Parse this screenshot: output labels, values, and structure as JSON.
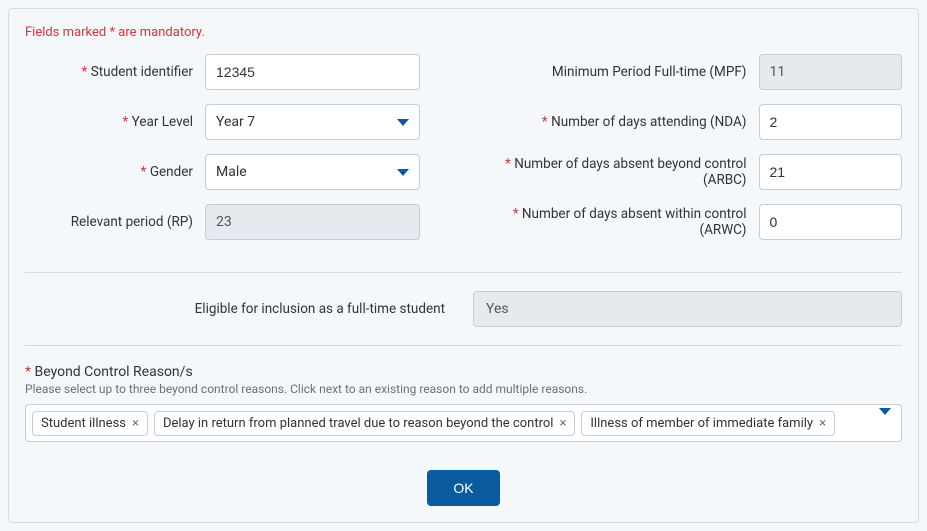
{
  "mandatory_note": {
    "prefix": "Fields marked ",
    "asterisk": "*",
    "suffix": " are mandatory."
  },
  "left": {
    "student_identifier": {
      "label": "Student identifier",
      "value": "12345"
    },
    "year_level": {
      "label": "Year Level",
      "value": "Year 7"
    },
    "gender": {
      "label": "Gender",
      "value": "Male"
    },
    "relevant_period": {
      "label": "Relevant period (RP)",
      "value": "23"
    }
  },
  "right": {
    "mpf": {
      "label": "Minimum Period Full-time (MPF)",
      "value": "11"
    },
    "nda": {
      "label": "Number of days attending (NDA)",
      "value": "2"
    },
    "arbc": {
      "label": "Number of days absent beyond control (ARBC)",
      "value": "21"
    },
    "arwc": {
      "label": "Number of days absent within control (ARWC)",
      "value": "0"
    }
  },
  "eligible": {
    "label": "Eligible for inclusion as a full-time student",
    "value": "Yes"
  },
  "beyond_control": {
    "label": "Beyond Control Reason/s",
    "hint": "Please select up to three beyond control reasons. Click next to an existing reason to add multiple reasons.",
    "selected": [
      "Student illness",
      "Delay in return from planned travel due to reason beyond the control",
      "Illness of member of immediate family"
    ]
  },
  "buttons": {
    "ok": "OK"
  }
}
